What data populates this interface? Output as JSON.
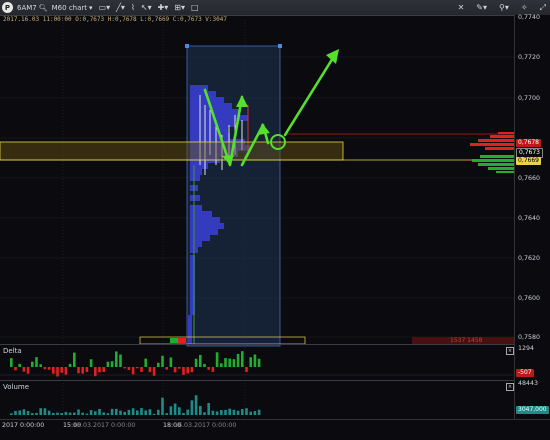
{
  "toolbar": {
    "symbol": "6AM7",
    "timeframe": "M60 chart"
  },
  "info_line": "2017.16.03 11:00:00   O:0,7673   H:0,7678   L:0,7669   C:0,7673   V:3047",
  "y_axis": {
    "labels": [
      "0,7740",
      "0,7720",
      "0,7700",
      "0,7680",
      "0,7660",
      "0,7640",
      "0,7620",
      "0,7600",
      "0,7580"
    ],
    "tag_high": "0,7678",
    "tag_mid": "0,7673",
    "tag_low": "0,7669"
  },
  "volume_box_label": "1537  1458",
  "delta": {
    "title": "Delta",
    "scale_label": "1294",
    "tag": "-507"
  },
  "volume": {
    "title": "Volume",
    "scale_label": "48443",
    "bottom_tag": "3047,000"
  },
  "x_axis": {
    "labels": [
      "2017  0:00:00",
      "15:00",
      "15.03.2017  0:00:00",
      "18:00",
      "16.03.2017  0:00:00"
    ]
  },
  "colors": {
    "accent_green": "#55e02b",
    "profile_blue": "#3b3fd6",
    "range_box": "#3f6fb8",
    "yellow": "#e8d44a",
    "bid_red": "#e22020",
    "ask_green": "#1fae2f"
  },
  "icons": [
    "logo-icon",
    "search-icon",
    "chart-type-icon",
    "line-tool-icon",
    "pencil-icon",
    "indicator-icon",
    "cursor-icon",
    "crosshair-icon",
    "settings-icon",
    "magnet-icon",
    "link-icon",
    "maximize-icon",
    "close-icon"
  ]
}
